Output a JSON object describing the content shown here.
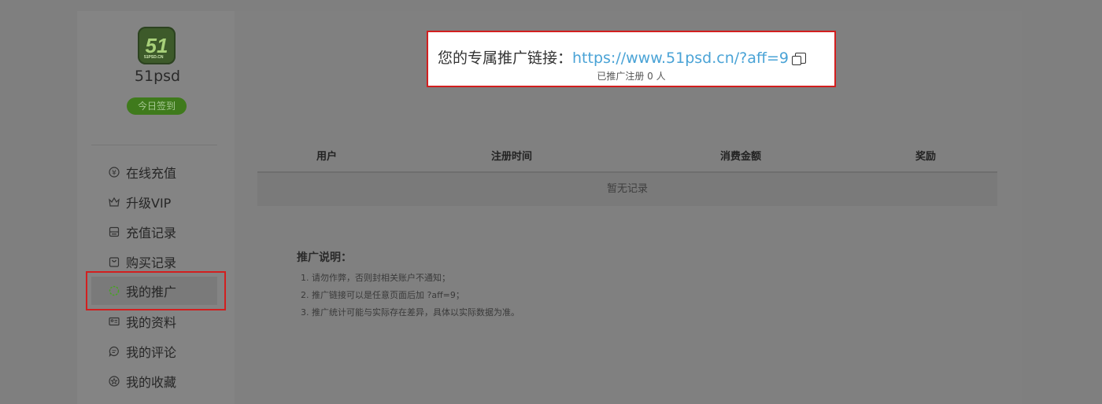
{
  "profile": {
    "avatar_text": "51",
    "avatar_sub": "51PSD.CN",
    "username": "51psd",
    "checkin_label": "今日签到"
  },
  "sidebar": {
    "items": [
      {
        "label": "在线充值",
        "icon": "yen-circle-icon"
      },
      {
        "label": "升级VIP",
        "icon": "crown-icon"
      },
      {
        "label": "充值记录",
        "icon": "receipt-icon"
      },
      {
        "label": "购买记录",
        "icon": "shopping-bag-icon"
      },
      {
        "label": "我的推广",
        "icon": "spinner-icon",
        "active": true
      },
      {
        "label": "我的资料",
        "icon": "id-card-icon"
      },
      {
        "label": "我的评论",
        "icon": "comment-icon"
      },
      {
        "label": "我的收藏",
        "icon": "star-circle-icon"
      }
    ]
  },
  "promo": {
    "prefix": "您的专属推广链接：",
    "url": "https://www.51psd.cn/?aff=9",
    "registered": "已推广注册 0 人"
  },
  "table": {
    "headers": [
      "用户",
      "注册时间",
      "消费金额",
      "奖励"
    ],
    "empty": "暂无记录"
  },
  "notes": {
    "title": "推广说明：",
    "items": [
      "1. 请勿作弊，否则封相关账户不通知；",
      "2. 推广链接可以是任意页面后加 ?aff=9；",
      "3. 推广统计可能与实际存在差异，具体以实际数据为准。"
    ]
  },
  "colors": {
    "accent_green": "#46a51f",
    "link_blue": "#4aa3d6",
    "highlight_red": "#d21f1f"
  }
}
